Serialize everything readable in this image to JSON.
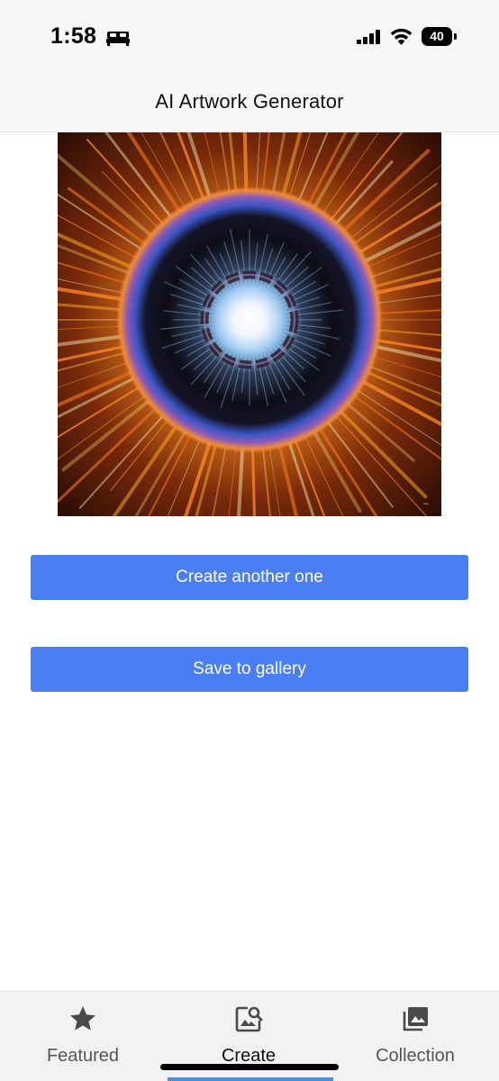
{
  "status_bar": {
    "time": "1:58",
    "battery_level": "40",
    "icons": [
      "bed-icon",
      "cellular-signal-icon",
      "wifi-icon",
      "battery-icon"
    ]
  },
  "header": {
    "title": "AI Artwork Generator"
  },
  "artwork": {
    "description_icon": "generated-artwork-image",
    "colors": {
      "rays": "#f5a623",
      "ring_blue": "#4a6cd8",
      "core": "#ffffff",
      "background": "#2a0f05"
    }
  },
  "actions": {
    "create_label": "Create another one",
    "save_label": "Save to gallery",
    "button_color": "#4a7ef2"
  },
  "tab_bar": {
    "tabs": [
      {
        "label": "Featured",
        "icon": "star-icon",
        "selected": false
      },
      {
        "label": "Create",
        "icon": "image-search-icon",
        "selected": true
      },
      {
        "label": "Collection",
        "icon": "photo-library-icon",
        "selected": false
      }
    ],
    "indicator_color": "#4a90d9"
  }
}
